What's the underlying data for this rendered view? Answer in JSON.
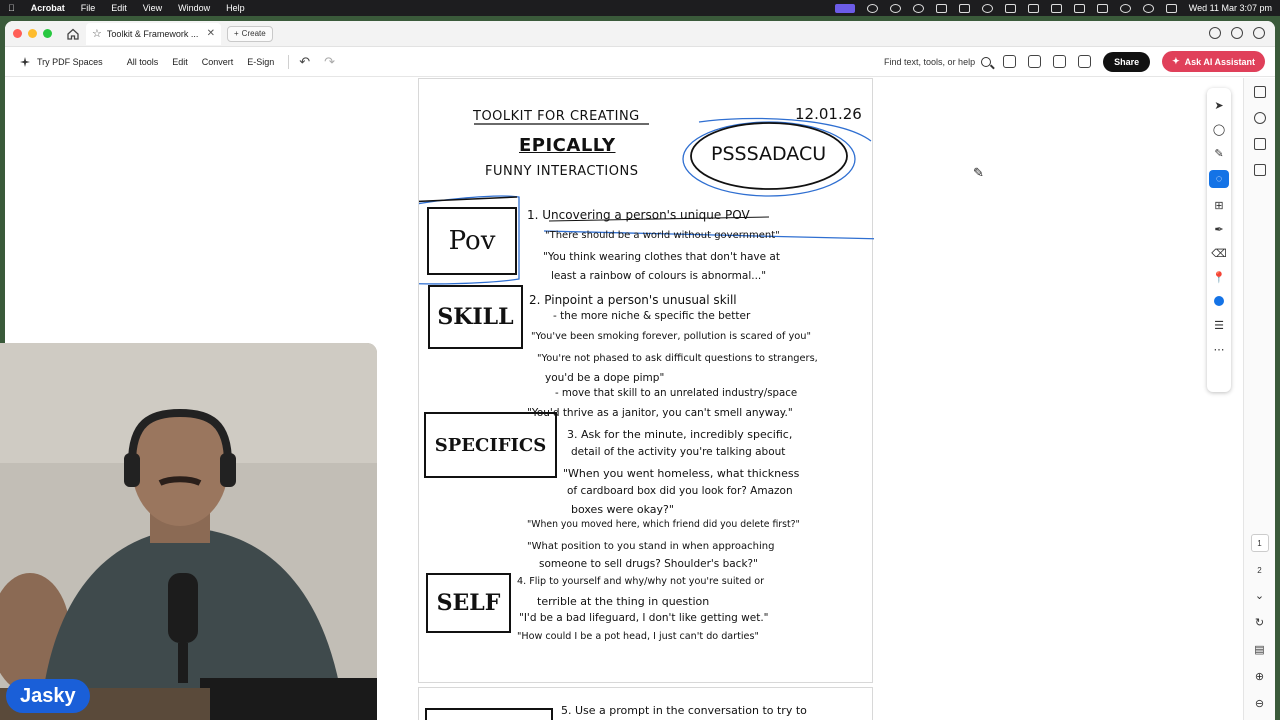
{
  "menubar": {
    "app": "Acrobat",
    "items": [
      "File",
      "Edit",
      "View",
      "Window",
      "Help"
    ],
    "datetime": "Wed 11 Mar  3:07 pm"
  },
  "tabbar": {
    "tab_label": "Toolkit & Framework ...",
    "create_label": "Create"
  },
  "toolbar": {
    "spaces": "Try PDF Spaces",
    "items": [
      "All tools",
      "Edit",
      "Convert",
      "E-Sign"
    ],
    "find": "Find text, tools, or help",
    "share": "Share",
    "ai": "Ask AI Assistant"
  },
  "document": {
    "title_line1": "TOOLKIT FOR CREATING",
    "title_line2": "EPICALLY",
    "title_line3": "FUNNY INTERACTIONS",
    "date": "12.01.26",
    "acronym": "PSSSADACU",
    "boxes": {
      "pov": "Pov",
      "skill": "SKILL",
      "specifics": "SPECIFICS",
      "self": "SELF"
    },
    "lines": [
      "1. Uncovering a person's unique POV",
      "\"There should be a world without government\"",
      "\"You think wearing clothes that don't have at",
      "least a rainbow of colours is abnormal...\"",
      "2. Pinpoint a person's unusual skill",
      "- the more niche & specific the better",
      "\"You've been smoking forever, pollution is scared of you\"",
      "\"You're not phased to ask difficult questions to strangers,",
      "you'd be a dope pimp\"",
      "- move that skill to an unrelated industry/space",
      "\"You'd thrive as a janitor, you can't smell anyway.\"",
      "3. Ask for the minute, incredibly specific,",
      "detail of the activity you're talking about",
      "\"When you went homeless, what thickness",
      "of cardboard box did you look for? Amazon",
      "boxes were okay?\"",
      "\"When you moved here, which friend did you delete first?\"",
      "\"What position to you stand in when approaching",
      "someone to sell drugs? Shoulder's back?\"",
      "4. Flip to yourself and why/why not you're suited or",
      "terrible at the thing in question",
      "\"I'd be a bad lifeguard, I don't like getting wet.\"",
      "\"How could I be a pot head, I just can't do darties\""
    ],
    "page2_line": "5. Use a prompt in the conversation to try to"
  },
  "sidebar_pages": [
    "1",
    "2"
  ],
  "overlay": {
    "name": "Jasky"
  }
}
